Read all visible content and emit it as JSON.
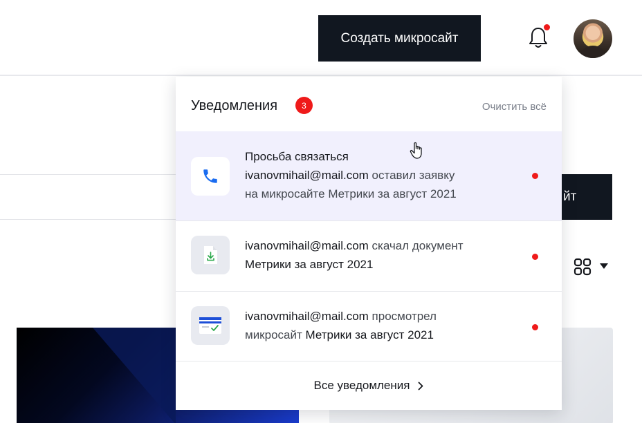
{
  "header": {
    "create_button_label": "Создать микросайт",
    "bell_has_unread": true
  },
  "background": {
    "dark_button_label_fragment": "йт"
  },
  "notifications_panel": {
    "title": "Уведомления",
    "unread_count": "3",
    "clear_all_label": "Очистить всё",
    "items": [
      {
        "icon": "phone-icon",
        "title": "Просьба связаться",
        "email": "ivanovmihail@mail.com",
        "action": " оставил заявку",
        "line3": "на микросайте Метрики за август 2021",
        "unread": true,
        "highlighted": true
      },
      {
        "icon": "document-download-icon",
        "email": "ivanovmihail@mail.com",
        "action": " скачал документ",
        "object": "Метрики за август 2021",
        "unread": true,
        "highlighted": false
      },
      {
        "icon": "card-check-icon",
        "email": "ivanovmihail@mail.com",
        "action": " просмотрел",
        "prefix2": "микросайт ",
        "object": "Метрики за август 2021",
        "unread": true,
        "highlighted": false
      }
    ],
    "footer_link_label": "Все уведомления"
  },
  "colors": {
    "accent_dark": "#111720",
    "badge_red": "#ef1a1a",
    "highlight_bg": "#f1f0fd",
    "phone_blue": "#1a6cf0"
  }
}
